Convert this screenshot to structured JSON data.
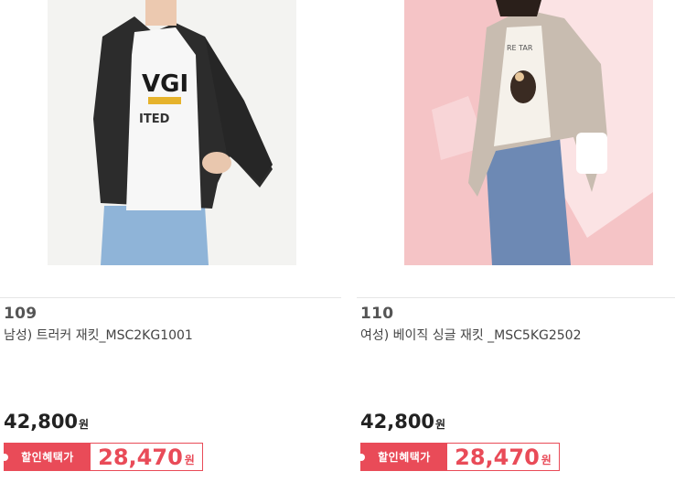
{
  "products": [
    {
      "number": "109",
      "name": "남성) 트러커 재킷_MSC2KG1001",
      "price": "42,800",
      "currency": "원",
      "discount_label": "할인혜택가",
      "sale_price": "28,470",
      "image_icon": "mens-trucker-jacket-photo"
    },
    {
      "number": "110",
      "name": "여성) 베이직 싱글 재킷 _MSC5KG2502",
      "price": "42,800",
      "currency": "원",
      "discount_label": "할인혜택가",
      "sale_price": "28,470",
      "image_icon": "womens-single-jacket-photo"
    }
  ],
  "colors": {
    "accent": "#e94b58",
    "left_photo_bg": "#f2f2f0",
    "right_photo_bg": "#f6c7c9"
  }
}
